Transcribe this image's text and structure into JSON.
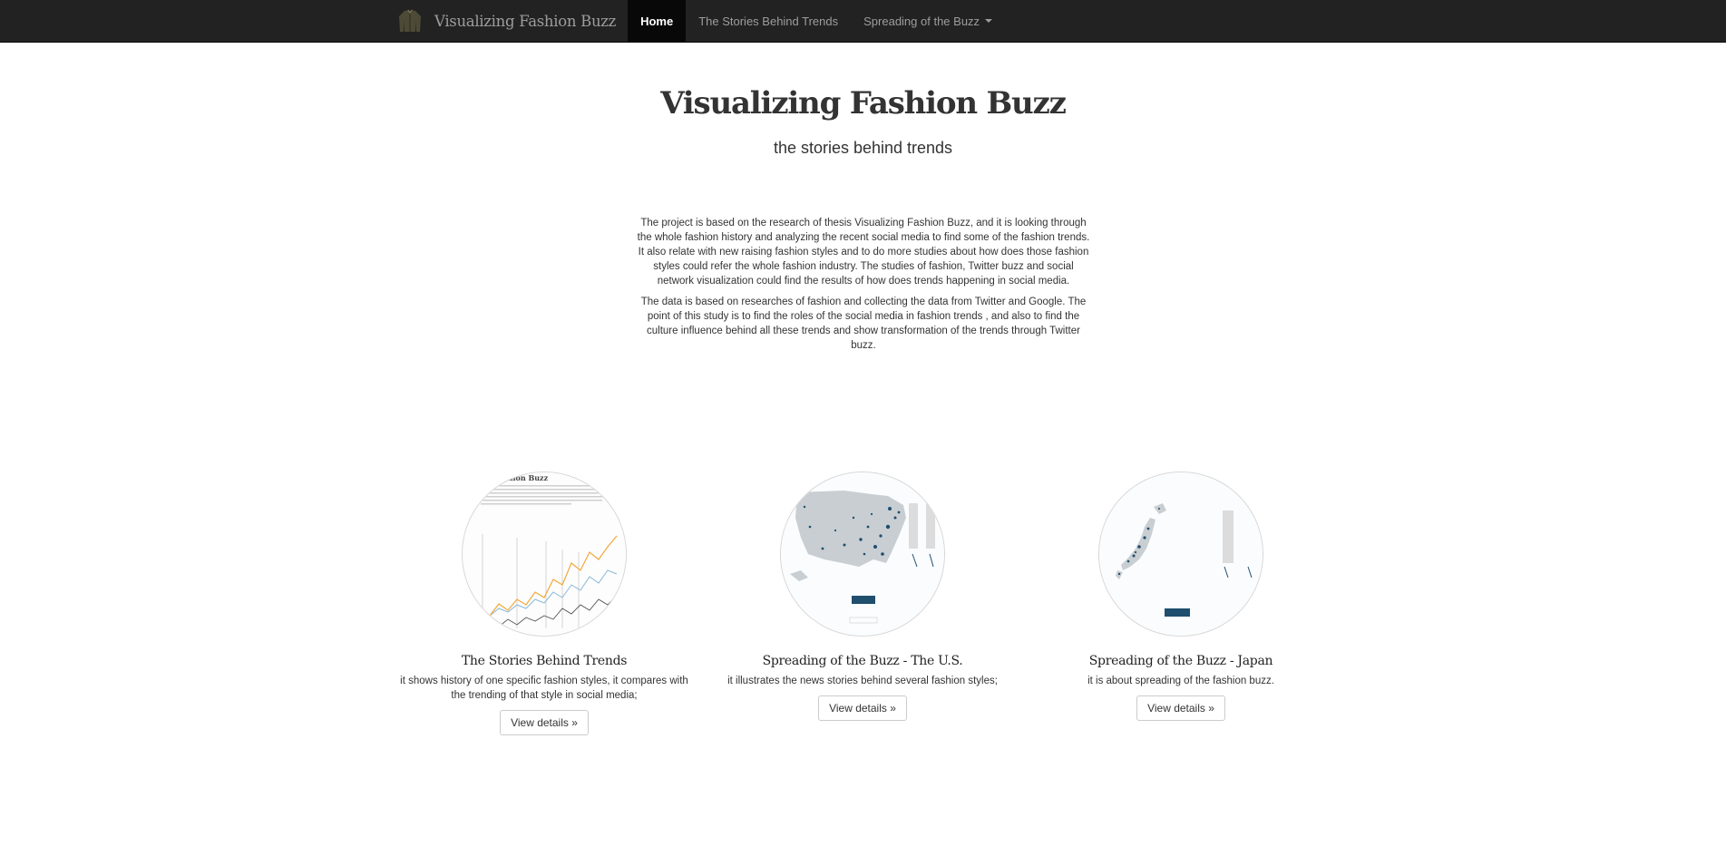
{
  "nav": {
    "brand": "Visualizing Fashion Buzz",
    "items": [
      {
        "label": "Home"
      },
      {
        "label": "The Stories Behind Trends"
      },
      {
        "label": "Spreading of the Buzz"
      }
    ]
  },
  "hero": {
    "title": "Visualizing Fashion Buzz",
    "subtitle": "the stories behind trends"
  },
  "intro": {
    "p1": "The project is based on the research of thesis Visualizing Fashion Buzz, and it is looking through the whole fashion history and analyzing the recent social media to find some of the fashion trends. It also relate with new raising fashion styles and to do more studies about how does those fashion styles could refer the whole fashion industry. The studies of fashion, Twitter buzz and social network visualization could find the results of how does trends happening in social media.",
    "p2": "The data is based on researches of fashion and collecting the data from Twitter and Google. The point of this study is to find the roles of the social media in fashion trends , and also to find the culture influence behind all these trends and show transformation of the trends through Twitter buzz."
  },
  "cards": [
    {
      "title": "The Stories Behind Trends",
      "desc": "it shows history of one specific fashion styles, it compares with the trending of that style in social media;",
      "button": "View details »"
    },
    {
      "title": "Spreading of the Buzz - The U.S.",
      "desc": "it illustrates the news stories behind several fashion styles;",
      "button": "View details »"
    },
    {
      "title": "Spreading of the Buzz - Japan",
      "desc": "it is about spreading of the fashion buzz.",
      "button": "View details »"
    }
  ],
  "colors": {
    "navbar": "#222222",
    "active_nav": "#080808",
    "map_dark": "#1f4e6e",
    "line_orange": "#f2a83a",
    "line_blue": "#8ab8d8"
  }
}
